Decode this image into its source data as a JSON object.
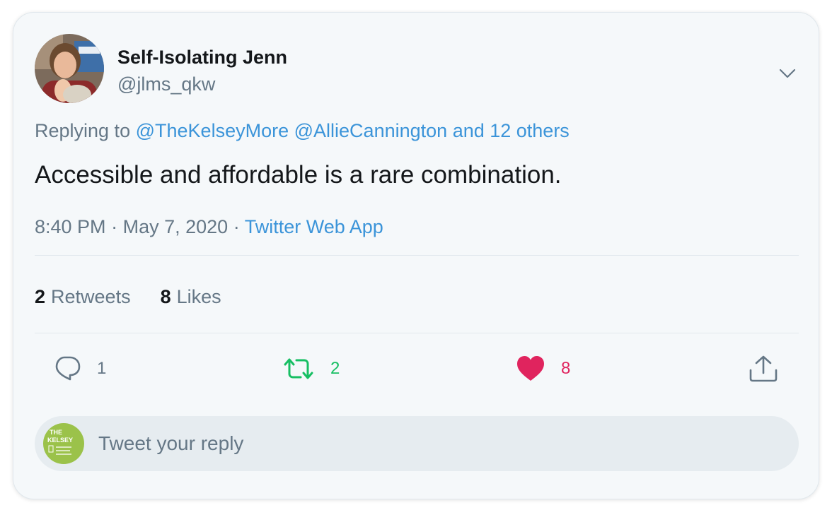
{
  "author": {
    "display_name": "Self-Isolating Jenn",
    "handle": "@jlms_qkw"
  },
  "replying": {
    "prefix": "Replying to",
    "mention1": "@TheKelseyMore",
    "mention2": "@AllieCannington",
    "others": "and 12 others"
  },
  "tweet": {
    "text": "Accessible and affordable is a rare combination."
  },
  "meta": {
    "time": "8:40 PM",
    "sep1": "·",
    "date": "May 7, 2020",
    "sep2": "·",
    "source": "Twitter Web App"
  },
  "stats": {
    "retweets_count": "2",
    "retweets_label": "Retweets",
    "likes_count": "8",
    "likes_label": "Likes"
  },
  "actions": {
    "reply_count": "1",
    "retweet_count": "2",
    "like_count": "8"
  },
  "reply_box": {
    "placeholder": "Tweet your reply",
    "avatar_line1": "THE",
    "avatar_line2": "KELSEY"
  },
  "icons": {
    "caret": "chevron-down-icon",
    "reply": "speech-bubble-icon",
    "retweet": "retweet-icon",
    "like": "heart-icon",
    "share": "share-icon"
  },
  "colors": {
    "link": "#3b94d9",
    "text_primary": "#14171a",
    "text_secondary": "#657786",
    "retweet_green": "#17bf63",
    "like_red": "#e0245e",
    "card_bg": "#f5f8fa",
    "reply_bar_bg": "#e6ecf0",
    "reply_avatar_bg": "#9bc24a"
  }
}
